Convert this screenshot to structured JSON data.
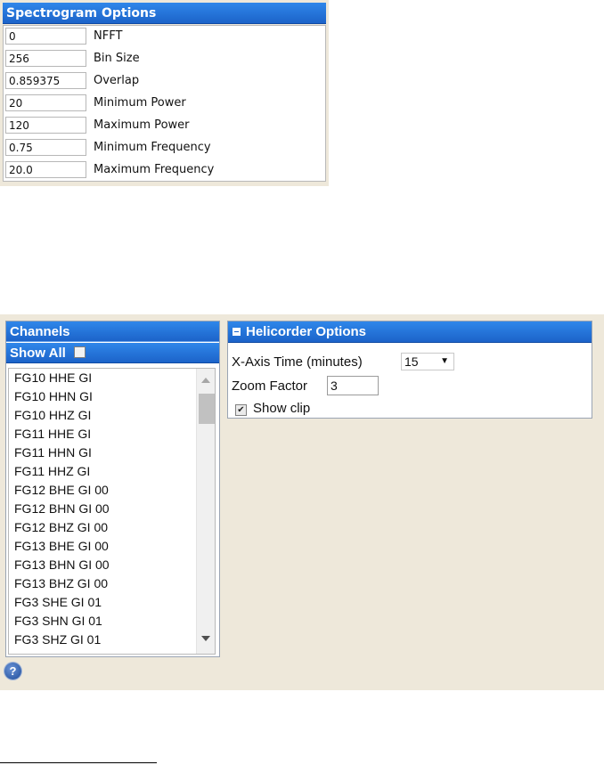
{
  "spectrogram": {
    "title": "Spectrogram Options",
    "fields": [
      {
        "value": "0",
        "label": "NFFT"
      },
      {
        "value": "256",
        "label": "Bin Size"
      },
      {
        "value": "0.859375",
        "label": "Overlap"
      },
      {
        "value": "20",
        "label": "Minimum Power"
      },
      {
        "value": "120",
        "label": "Maximum Power"
      },
      {
        "value": "0.75",
        "label": "Minimum Frequency"
      },
      {
        "value": "20.0",
        "label": "Maximum Frequency"
      }
    ]
  },
  "channels": {
    "title": "Channels",
    "show_all_label": "Show All",
    "show_all_checked": false,
    "items": [
      "FG10 HHE GI",
      "FG10 HHN GI",
      "FG10 HHZ GI",
      "FG11 HHE GI",
      "FG11 HHN GI",
      "FG11 HHZ GI",
      "FG12 BHE GI 00",
      "FG12 BHN GI 00",
      "FG12 BHZ GI 00",
      "FG13 BHE GI 00",
      "FG13 BHN GI 00",
      "FG13 BHZ GI 00",
      "FG3 SHE GI 01",
      "FG3 SHN GI 01",
      "FG3 SHZ GI 01"
    ]
  },
  "helicorder": {
    "title": "Helicorder Options",
    "xaxis_label": "X-Axis Time (minutes)",
    "xaxis_value": "15",
    "zoom_label": "Zoom Factor",
    "zoom_value": "3",
    "show_clip_label": "Show clip",
    "show_clip_checked": true
  },
  "help": {
    "glyph": "?"
  },
  "colors": {
    "header_blue": "#1c63c9",
    "panel_bg": "#eee8da"
  }
}
